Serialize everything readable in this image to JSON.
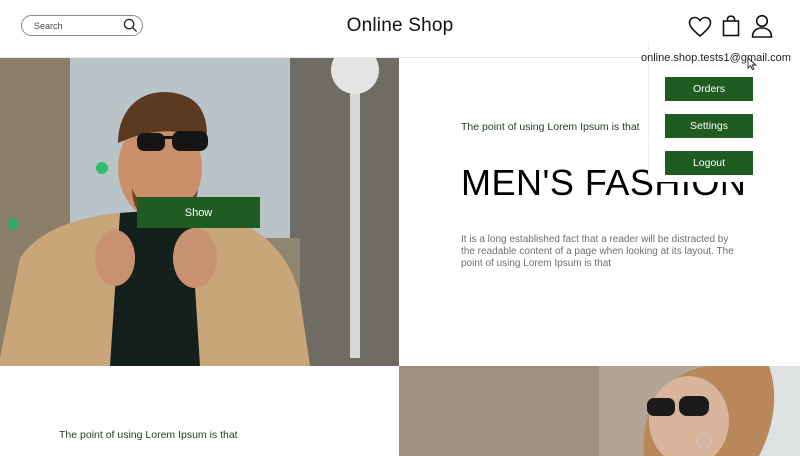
{
  "header": {
    "title": "Online Shop",
    "search": {
      "placeholder": "Search"
    },
    "icons": [
      "search-icon",
      "heart-icon",
      "shopping-bag-icon",
      "user-icon"
    ]
  },
  "hero": {
    "show_label": "Show",
    "tagline": "The point of using Lorem Ipsum is that",
    "headline": "MEN'S FASHION",
    "body": "It is a long established fact that a reader will be distracted by the readable content of a page when looking at its layout. The point of using Lorem Ipsum is that"
  },
  "bottom": {
    "tagline": "The point of using Lorem Ipsum is that"
  },
  "user_menu": {
    "email": "online.shop.tests1@gmail.com",
    "items": [
      {
        "label": "Orders"
      },
      {
        "label": "Settings"
      },
      {
        "label": "Logout"
      }
    ]
  },
  "colors": {
    "accent_green": "#1e5c22",
    "tagline_green": "#1e3d1e",
    "body_gray": "#6f6f6f"
  }
}
